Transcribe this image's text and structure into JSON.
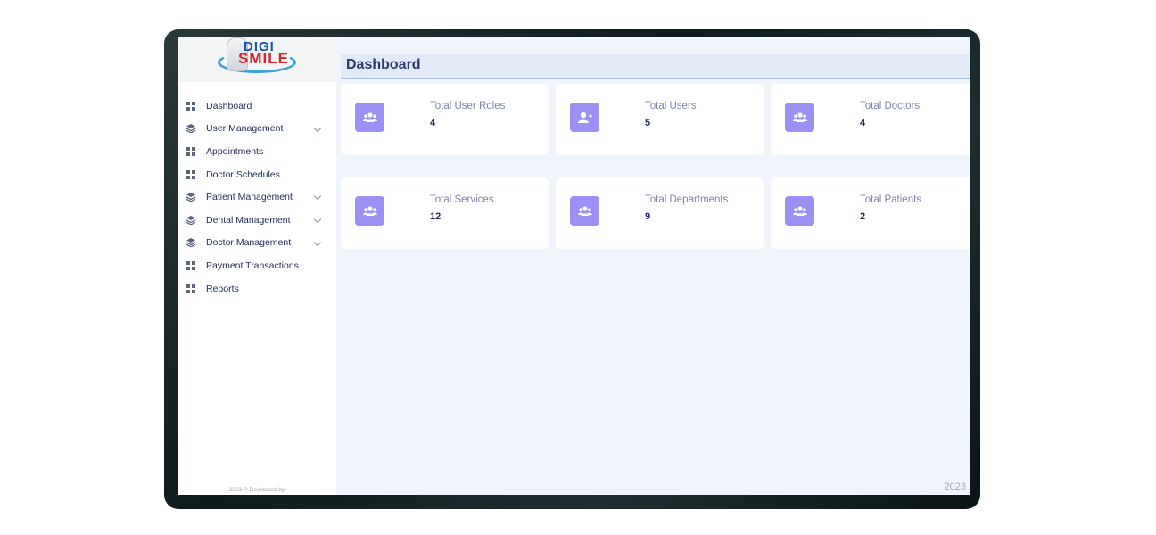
{
  "brand": {
    "logo_line1": "DIGI",
    "logo_line2": "SMILE",
    "colors": {
      "digi": "#1b4fb8",
      "smile": "#d8232a",
      "swoosh": "#3aa0d8"
    }
  },
  "sidebar": {
    "items": [
      {
        "label": "Dashboard",
        "icon": "grid-icon",
        "expandable": false
      },
      {
        "label": "User Management",
        "icon": "layers-icon",
        "expandable": true
      },
      {
        "label": "Appointments",
        "icon": "grid-icon",
        "expandable": false
      },
      {
        "label": "Doctor Schedules",
        "icon": "grid-icon",
        "expandable": false
      },
      {
        "label": "Patient Management",
        "icon": "layers-icon",
        "expandable": true
      },
      {
        "label": "Dental Management",
        "icon": "layers-icon",
        "expandable": true
      },
      {
        "label": "Doctor Management",
        "icon": "layers-icon",
        "expandable": true
      },
      {
        "label": "Payment Transactions",
        "icon": "grid-icon",
        "expandable": false
      },
      {
        "label": "Reports",
        "icon": "grid-icon",
        "expandable": false
      }
    ],
    "footer_credit": "2023 © Developed by"
  },
  "header": {
    "title": "Dashboard"
  },
  "cards": [
    {
      "label": "Total User Roles",
      "value": "4",
      "icon": "users-group-icon"
    },
    {
      "label": "Total Users",
      "value": "5",
      "icon": "user-plus-icon"
    },
    {
      "label": "Total Doctors",
      "value": "4",
      "icon": "users-group-icon"
    },
    {
      "label": "Total Services",
      "value": "12",
      "icon": "users-group-icon"
    },
    {
      "label": "Total Departments",
      "value": "9",
      "icon": "users-group-icon"
    },
    {
      "label": "Total Patients",
      "value": "2",
      "icon": "users-group-icon"
    }
  ],
  "footer": {
    "year": "2023"
  },
  "theme": {
    "accent": "#9d90f5",
    "text": "#1f2a55",
    "muted": "#7a84ad",
    "bg": "#f0f5fc"
  }
}
